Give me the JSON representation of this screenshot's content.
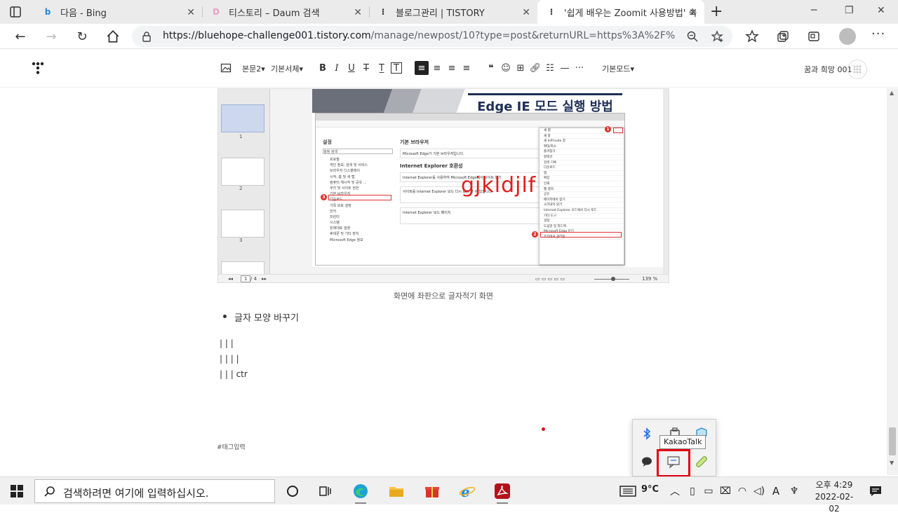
{
  "browser": {
    "tabs": [
      {
        "title": "다음 - Bing",
        "favicon": "bing-icon",
        "active": false
      },
      {
        "title": "티스토리 – Daum 검색",
        "favicon": "daum-icon",
        "active": false
      },
      {
        "title": "블로그관리 | TISTORY",
        "favicon": "tistory-icon",
        "active": false
      },
      {
        "title": "'쉽게 배우는 Zoomit 사용방법' 숙",
        "favicon": "tistory-icon",
        "active": true
      }
    ],
    "url_host": "https://bluehope-challenge001.tistory.com",
    "url_path": "/manage/newpost/10?type=post&returnURL=https%3A%2F%2Fbluehope..."
  },
  "editor": {
    "toolbar": {
      "paragraph_style": "본문2",
      "font": "기본서체",
      "mode": "기본모드"
    },
    "user_name": "꿈과 희망 001"
  },
  "embed": {
    "slide_title": "Edge IE 모드 실행 방법",
    "thumb_labels": [
      "1",
      "2",
      "3"
    ],
    "scribble": "gjkldjlf",
    "page_indicator": "1",
    "page_total": "/ 4",
    "zoom": "139 %",
    "sidebar": {
      "heading": "설정",
      "search": "설정 검색",
      "items": [
        "프로필",
        "개인 정보, 검색 및 서비스",
        "브라우저 디스플레이",
        "시작, 홈 및 새 탭",
        "컴퓨터 재시작 및 공유 ...",
        "쿠키 및 사이트 권한",
        "기본 브라우저",
        "다운로드",
        "가족 보호 설정",
        "언어",
        "프린터",
        "시스템",
        "원래대로 설정",
        "휴대폰 및 기타 장치",
        "Microsoft Edge 정보"
      ]
    },
    "main": {
      "heading": "기본 브라우저",
      "card1": "Microsoft Edge가 기본 브라우저입니다.",
      "section": "Internet Explorer 호환성",
      "card2": "Internet Explorer를 사용하여 Microsoft Edge에서 사이트 열기",
      "card3": "사이트를 Internet Explorer 모드 다시 로드 할 수 있습니다.",
      "card4": "Internet Explorer 모드 페이지"
    },
    "menu_items": [
      "새 탭",
      "새 창",
      "새 InPrivate 창",
      "확대/축소",
      "즐겨찾기",
      "컬렉션",
      "검색 기록",
      "다운로드",
      "앱",
      "확장",
      "인쇄",
      "웹 캡처",
      "공유",
      "페이지에서 찾기",
      "소리내어 읽기",
      "Internet Explorer 모드에서 다시 로드",
      "기타 도구",
      "설정",
      "도움말 및 피드백",
      "Microsoft Edge 닫기",
      "조직에서 관리됨"
    ],
    "markers": [
      "1",
      "2",
      "3"
    ]
  },
  "content": {
    "caption": "화면에 좌판으로 글자적기 화면",
    "bullet": "글자 모양 바꾸기",
    "lines": [
      "| | |",
      "| | | |",
      "| | | ctr"
    ],
    "tags": "#태그입력"
  },
  "tray_popup": {
    "tooltip": "KakaoTalk",
    "icons": [
      "bluetooth-icon",
      "usb-drive-icon",
      "shield-icon",
      "chat-bubble-icon",
      "kakaotalk-icon",
      "pill-icon"
    ]
  },
  "taskbar": {
    "search_placeholder": "검색하려면 여기에 입력하십시오.",
    "weather": "9°C",
    "time": "오후 4:29",
    "date": "2022-02-02",
    "accent": "#e3000f"
  }
}
